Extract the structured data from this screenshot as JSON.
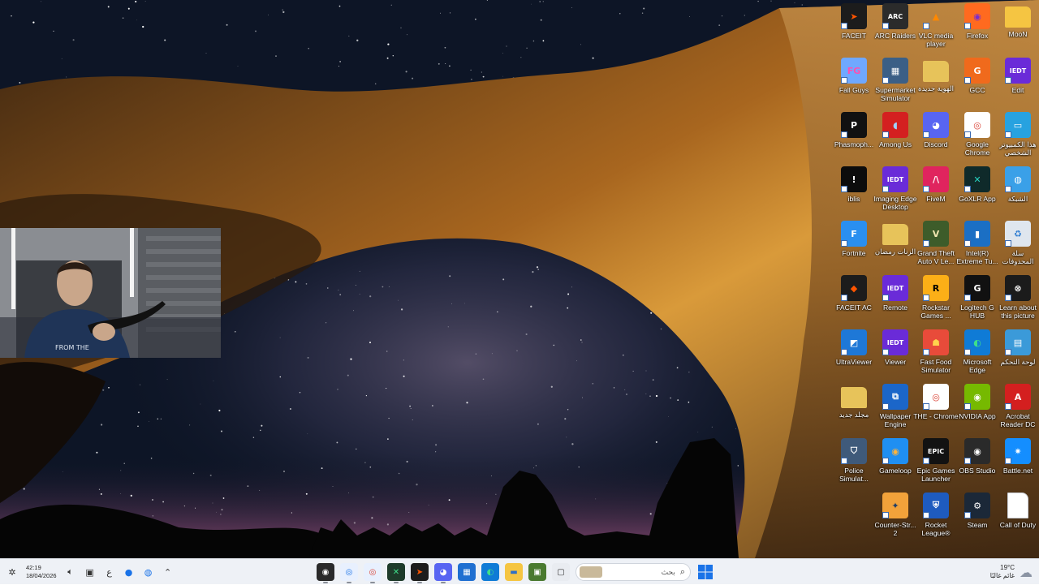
{
  "desktop": {
    "icons": [
      {
        "label": "FACEIT",
        "icon": "faceit-icon",
        "color": "#1c1c1c",
        "glyph": "➤",
        "fg": "#ff5500"
      },
      {
        "label": "ARC Raiders",
        "icon": "arc-raiders-icon",
        "color": "#2b2b2b",
        "glyph": "ARC",
        "fg": "#ffffff"
      },
      {
        "label": "VLC media player",
        "icon": "vlc-icon",
        "color": "transparent",
        "glyph": "▲",
        "fg": "#ff8800"
      },
      {
        "label": "Firefox",
        "icon": "firefox-icon",
        "color": "#ff6a1f",
        "glyph": "◉",
        "fg": "#7b2ccf"
      },
      {
        "label": "MooN",
        "icon": "folder-icon",
        "color": "#f5c542",
        "glyph": "",
        "fg": "#ffffff"
      },
      {
        "label": "Fall Guys",
        "icon": "fall-guys-icon",
        "color": "#6fa8ff",
        "glyph": "FG",
        "fg": "#ff4fb0"
      },
      {
        "label": "Supermarket Simulator",
        "icon": "supermarket-simulator-icon",
        "color": "#3b5f86",
        "glyph": "▦",
        "fg": "#ffffff"
      },
      {
        "label": "الهوية جديدة",
        "icon": "folder-icon",
        "color": "#e7c35a",
        "glyph": "",
        "fg": "#ffffff"
      },
      {
        "label": "GCC",
        "icon": "gcc-icon",
        "color": "#f06a1c",
        "glyph": "G",
        "fg": "#ffffff"
      },
      {
        "label": "Edit",
        "icon": "iedt-edit-icon",
        "color": "#6a2bd8",
        "glyph": "IEDT",
        "fg": "#ffffff"
      },
      {
        "label": "Phasmoph...",
        "icon": "phasmophobia-icon",
        "color": "#111111",
        "glyph": "P",
        "fg": "#ffffff"
      },
      {
        "label": "Among Us",
        "icon": "among-us-icon",
        "color": "#d42020",
        "glyph": "◖",
        "fg": "#9fd3ff"
      },
      {
        "label": "Discord",
        "icon": "discord-icon",
        "color": "#5865f2",
        "glyph": "◕",
        "fg": "#ffffff"
      },
      {
        "label": "Google Chrome",
        "icon": "chrome-icon",
        "color": "#ffffff",
        "glyph": "◎",
        "fg": "#db4437"
      },
      {
        "label": "هذا الكمبيوتر الشخصي",
        "icon": "this-pc-icon",
        "color": "#27a2e0",
        "glyph": "▭",
        "fg": "#ffffff"
      },
      {
        "label": "iblis",
        "icon": "iblis-icon",
        "color": "#0c0c0c",
        "glyph": "!",
        "fg": "#ffffff"
      },
      {
        "label": "Imaging Edge Desktop",
        "icon": "imaging-edge-icon",
        "color": "#6a2bd8",
        "glyph": "IEDT",
        "fg": "#ffffff"
      },
      {
        "label": "FiveM",
        "icon": "fivem-icon",
        "color": "#e0245e",
        "glyph": "/\\",
        "fg": "#ffffff"
      },
      {
        "label": "GoXLR App",
        "icon": "goxlr-icon",
        "color": "#0f2a2a",
        "glyph": "✕",
        "fg": "#27d3c0"
      },
      {
        "label": "الشبكة",
        "icon": "network-icon",
        "color": "#3aa0e8",
        "glyph": "◍",
        "fg": "#ffffff"
      },
      {
        "label": "Fortnite",
        "icon": "fortnite-icon",
        "color": "#2a8ff0",
        "glyph": "F",
        "fg": "#ffffff"
      },
      {
        "label": "الزنات رمضان",
        "icon": "folder-icon",
        "color": "#e7c35a",
        "glyph": "",
        "fg": "#ffffff"
      },
      {
        "label": "Grand Theft Auto V Le...",
        "icon": "gta-v-icon",
        "color": "#3d5c2a",
        "glyph": "V",
        "fg": "#f0e6b0"
      },
      {
        "label": "Intel(R) Extreme Tu...",
        "icon": "intel-xtu-icon",
        "color": "#1b6fc4",
        "glyph": "▮",
        "fg": "#ffffff"
      },
      {
        "label": "سلة المحذوفات",
        "icon": "recycle-bin-icon",
        "color": "#dfe6ee",
        "glyph": "♻",
        "fg": "#2b7bd0"
      },
      {
        "label": "FACEIT AC",
        "icon": "faceit-ac-icon",
        "color": "#1c1c1c",
        "glyph": "◆",
        "fg": "#ff5500"
      },
      {
        "label": "Remote",
        "icon": "iedt-remote-icon",
        "color": "#6a2bd8",
        "glyph": "IEDT",
        "fg": "#ffffff"
      },
      {
        "label": "Rockstar Games ...",
        "icon": "rockstar-icon",
        "color": "#fcaf17",
        "glyph": "R",
        "fg": "#000000"
      },
      {
        "label": "Logitech G HUB",
        "icon": "logitech-ghub-icon",
        "color": "#111111",
        "glyph": "G",
        "fg": "#ffffff"
      },
      {
        "label": "Learn about this picture",
        "icon": "learn-picture-icon",
        "color": "#1b1b1b",
        "glyph": "⊗",
        "fg": "#ffffff"
      },
      {
        "label": "UltraViewer",
        "icon": "ultraviewer-icon",
        "color": "#1e78d7",
        "glyph": "◩",
        "fg": "#ffffff"
      },
      {
        "label": "Viewer",
        "icon": "iedt-viewer-icon",
        "color": "#6a2bd8",
        "glyph": "IEDT",
        "fg": "#ffffff"
      },
      {
        "label": "Fast Food Simulator",
        "icon": "fast-food-simulator-icon",
        "color": "#e84b3a",
        "glyph": "☗",
        "fg": "#ffd34d"
      },
      {
        "label": "Microsoft Edge",
        "icon": "edge-icon",
        "color": "#0f7bd6",
        "glyph": "◐",
        "fg": "#3ee08a"
      },
      {
        "label": "لوحة التحكم",
        "icon": "control-panel-icon",
        "color": "#3b9ad9",
        "glyph": "▤",
        "fg": "#ffffff"
      },
      {
        "label": "مجلد جديد",
        "icon": "folder-icon",
        "color": "#e7c35a",
        "glyph": "",
        "fg": "#ffffff"
      },
      {
        "label": "Wallpaper Engine",
        "icon": "wallpaper-engine-icon",
        "color": "#1b66c9",
        "glyph": "⧉",
        "fg": "#ffffff"
      },
      {
        "label": "THE - Chrome",
        "icon": "chrome-profile-icon",
        "color": "#ffffff",
        "glyph": "◎",
        "fg": "#db4437"
      },
      {
        "label": "NVIDIA App",
        "icon": "nvidia-icon",
        "color": "#76b900",
        "glyph": "◉",
        "fg": "#ffffff"
      },
      {
        "label": "Acrobat Reader DC",
        "icon": "acrobat-icon",
        "color": "#d41f1f",
        "glyph": "A",
        "fg": "#ffffff"
      },
      {
        "label": "Police Simulat...",
        "icon": "police-simulator-icon",
        "color": "#3f5a7a",
        "glyph": "⛉",
        "fg": "#ffffff"
      },
      {
        "label": "Gameloop",
        "icon": "gameloop-icon",
        "color": "#1f8ff2",
        "glyph": "◉",
        "fg": "#ffb43d"
      },
      {
        "label": "Epic Games Launcher",
        "icon": "epic-games-icon",
        "color": "#121212",
        "glyph": "EPIC",
        "fg": "#ffffff"
      },
      {
        "label": "OBS Studio",
        "icon": "obs-icon",
        "color": "#2a2a2a",
        "glyph": "◉",
        "fg": "#ffffff"
      },
      {
        "label": "Battle.net",
        "icon": "battlenet-icon",
        "color": "#148eff",
        "glyph": "✷",
        "fg": "#ffffff"
      },
      {
        "label": "",
        "icon": "empty-slot",
        "color": "transparent",
        "glyph": "",
        "fg": "#ffffff"
      },
      {
        "label": "Counter-Str... 2",
        "icon": "counter-strike-icon",
        "color": "#f2a23a",
        "glyph": "✦",
        "fg": "#1f3e66"
      },
      {
        "label": "Rocket League®",
        "icon": "rocket-league-icon",
        "color": "#1e5bbf",
        "glyph": "⛨",
        "fg": "#ffffff"
      },
      {
        "label": "Steam",
        "icon": "steam-icon",
        "color": "#1b2838",
        "glyph": "⚙",
        "fg": "#ffffff"
      },
      {
        "label": "Call of Duty",
        "icon": "blank-file-icon",
        "color": "#ffffff",
        "glyph": "",
        "fg": "#ffffff"
      }
    ]
  },
  "taskbar": {
    "time": "42:19",
    "date": "18/04/2026",
    "language": "ع",
    "search_placeholder": "بحث",
    "weather_temp": "19°C",
    "weather_desc": "غائم غالبًا",
    "apps": [
      {
        "name": "obs-taskbar-icon",
        "color": "#2a2a2a",
        "glyph": "◉",
        "fg": "#ffffff",
        "running": true
      },
      {
        "name": "chrome-taskbar-icon",
        "color": "#e8f0fe",
        "glyph": "◎",
        "fg": "#1a73e8",
        "running": true
      },
      {
        "name": "chrome-profile-taskbar-icon",
        "color": "#e8f0fe",
        "glyph": "◎",
        "fg": "#db4437",
        "running": true
      },
      {
        "name": "terminal-taskbar-icon",
        "color": "#1e3b2a",
        "glyph": "✕",
        "fg": "#3ee08a",
        "running": true
      },
      {
        "name": "faceit-taskbar-icon",
        "color": "#1c1c1c",
        "glyph": "➤",
        "fg": "#ff5500",
        "running": true
      },
      {
        "name": "discord-taskbar-icon",
        "color": "#5865f2",
        "glyph": "◕",
        "fg": "#ffffff",
        "running": true
      },
      {
        "name": "store-taskbar-icon",
        "color": "#1f6fd1",
        "glyph": "▦",
        "fg": "#ffffff",
        "running": false
      },
      {
        "name": "edge-taskbar-icon",
        "color": "#0f7bd6",
        "glyph": "◐",
        "fg": "#3ee08a",
        "running": false
      },
      {
        "name": "file-explorer-taskbar-icon",
        "color": "#f5c542",
        "glyph": "▬",
        "fg": "#2f6fc7",
        "running": false
      },
      {
        "name": "minecraft-taskbar-icon",
        "color": "#4a7a30",
        "glyph": "▣",
        "fg": "#ffffff",
        "running": false
      },
      {
        "name": "task-view-taskbar-icon",
        "color": "#e9ecf1",
        "glyph": "▢",
        "fg": "#333333",
        "running": false
      }
    ]
  }
}
